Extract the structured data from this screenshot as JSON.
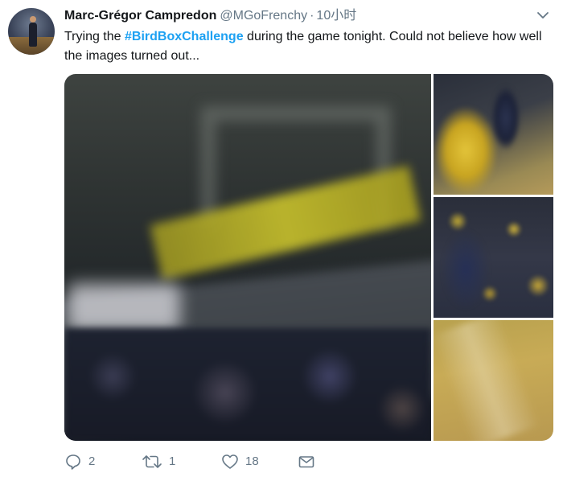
{
  "tweet": {
    "author_name": "Marc-Grégor Campredon",
    "handle": "@MGoFrenchy",
    "separator": "·",
    "time": "10小时",
    "text_before": "Trying the ",
    "hashtag": "#BirdBoxChallenge",
    "text_after": " during the game tonight. Could not believe how well the images turned out...",
    "actions": {
      "reply_count": "2",
      "retweet_count": "1",
      "like_count": "18"
    }
  },
  "icons": {
    "caret": "chevron-down-icon",
    "reply": "reply-icon",
    "retweet": "retweet-icon",
    "like": "heart-icon",
    "dm": "envelope-icon"
  },
  "colors": {
    "hashtag": "#1da1f2",
    "secondary_text": "#657786",
    "primary_text": "#14171a"
  }
}
